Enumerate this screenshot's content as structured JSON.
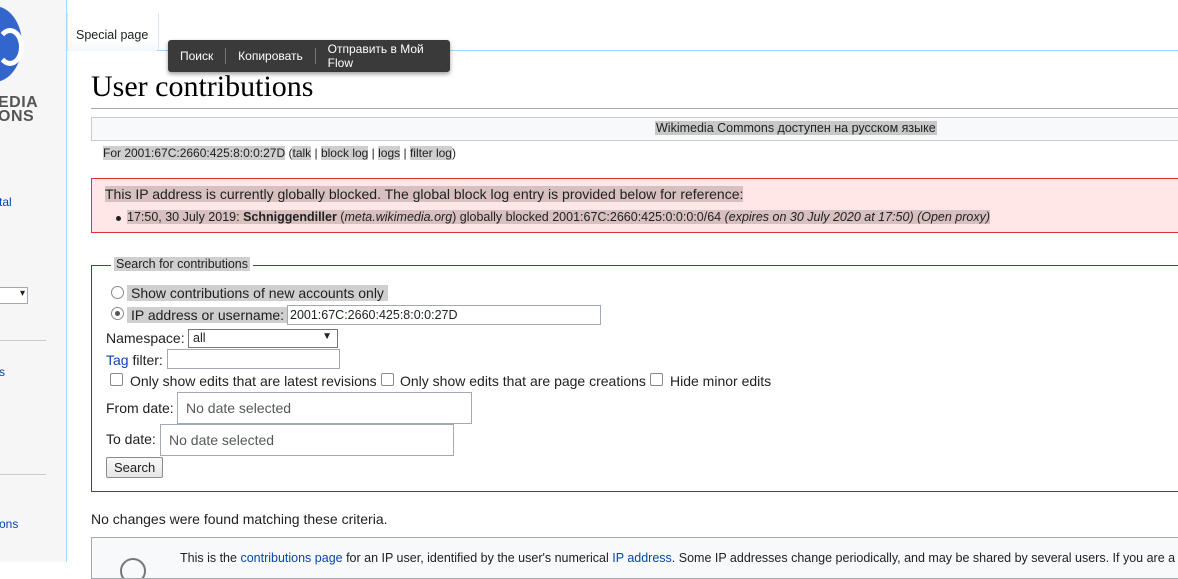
{
  "sidebar": {
    "logo_text_line1": "EDIA",
    "logo_text_line2": "ONS",
    "link1": "tal",
    "link2": "s",
    "link3": "ons",
    "select_arrow": "▾"
  },
  "tabs": {
    "special_page": "Special page"
  },
  "context_menu": {
    "items": [
      "Поиск",
      "Копировать",
      "Отправить в Мой Flow"
    ]
  },
  "page": {
    "title": "User contributions",
    "language_notice": "Wikimedia Commons доступен на русском языке",
    "for_line": {
      "prefix": "For 2001:67C:2660:425:8:0:0:27D",
      "open": " (",
      "talk": "talk",
      "sep": " | ",
      "block_log": "block log",
      "logs": "logs",
      "filter_log": "filter log",
      "close": ")"
    },
    "block_notice": {
      "headline": "This IP address is currently globally blocked. The global block log entry is provided below for reference:",
      "timestamp": "17:50, 30 July 2019: ",
      "user": "Schniggendiller",
      "wiki_open": " (",
      "wiki": "meta.wikimedia.org",
      "action": ") globally blocked 2001:67C:2660:425:0:0:0:0/64 ",
      "expiry": "(expires on 30 July 2020 at 17:50) (Open proxy)"
    },
    "search": {
      "legend": "Search for contributions",
      "opt_new_accounts": "Show contributions of new accounts only",
      "opt_ip_label": "IP address or username:",
      "ip_value": "2001:67C:2660:425:8:0:0:27D",
      "namespace_label": "Namespace:",
      "namespace_value": "all",
      "tag_link": "Tag",
      "tag_label": " filter:",
      "chk_latest": "Only show edits that are latest revisions",
      "chk_creations": "Only show edits that are page creations",
      "chk_minor": "Hide minor edits",
      "from_label": "From date:",
      "from_placeholder": "No date selected",
      "to_label": "To date:",
      "to_placeholder": "No date selected",
      "search_button": "Search"
    },
    "no_changes": "No changes were found matching these criteria.",
    "info": {
      "t1": "This is the ",
      "link1": "contributions page",
      "t2": " for an IP user, identified by the user's numerical ",
      "link2": "IP address",
      "t3": ". Some IP addresses change periodically, and may be shared by several users. If you are a"
    }
  }
}
